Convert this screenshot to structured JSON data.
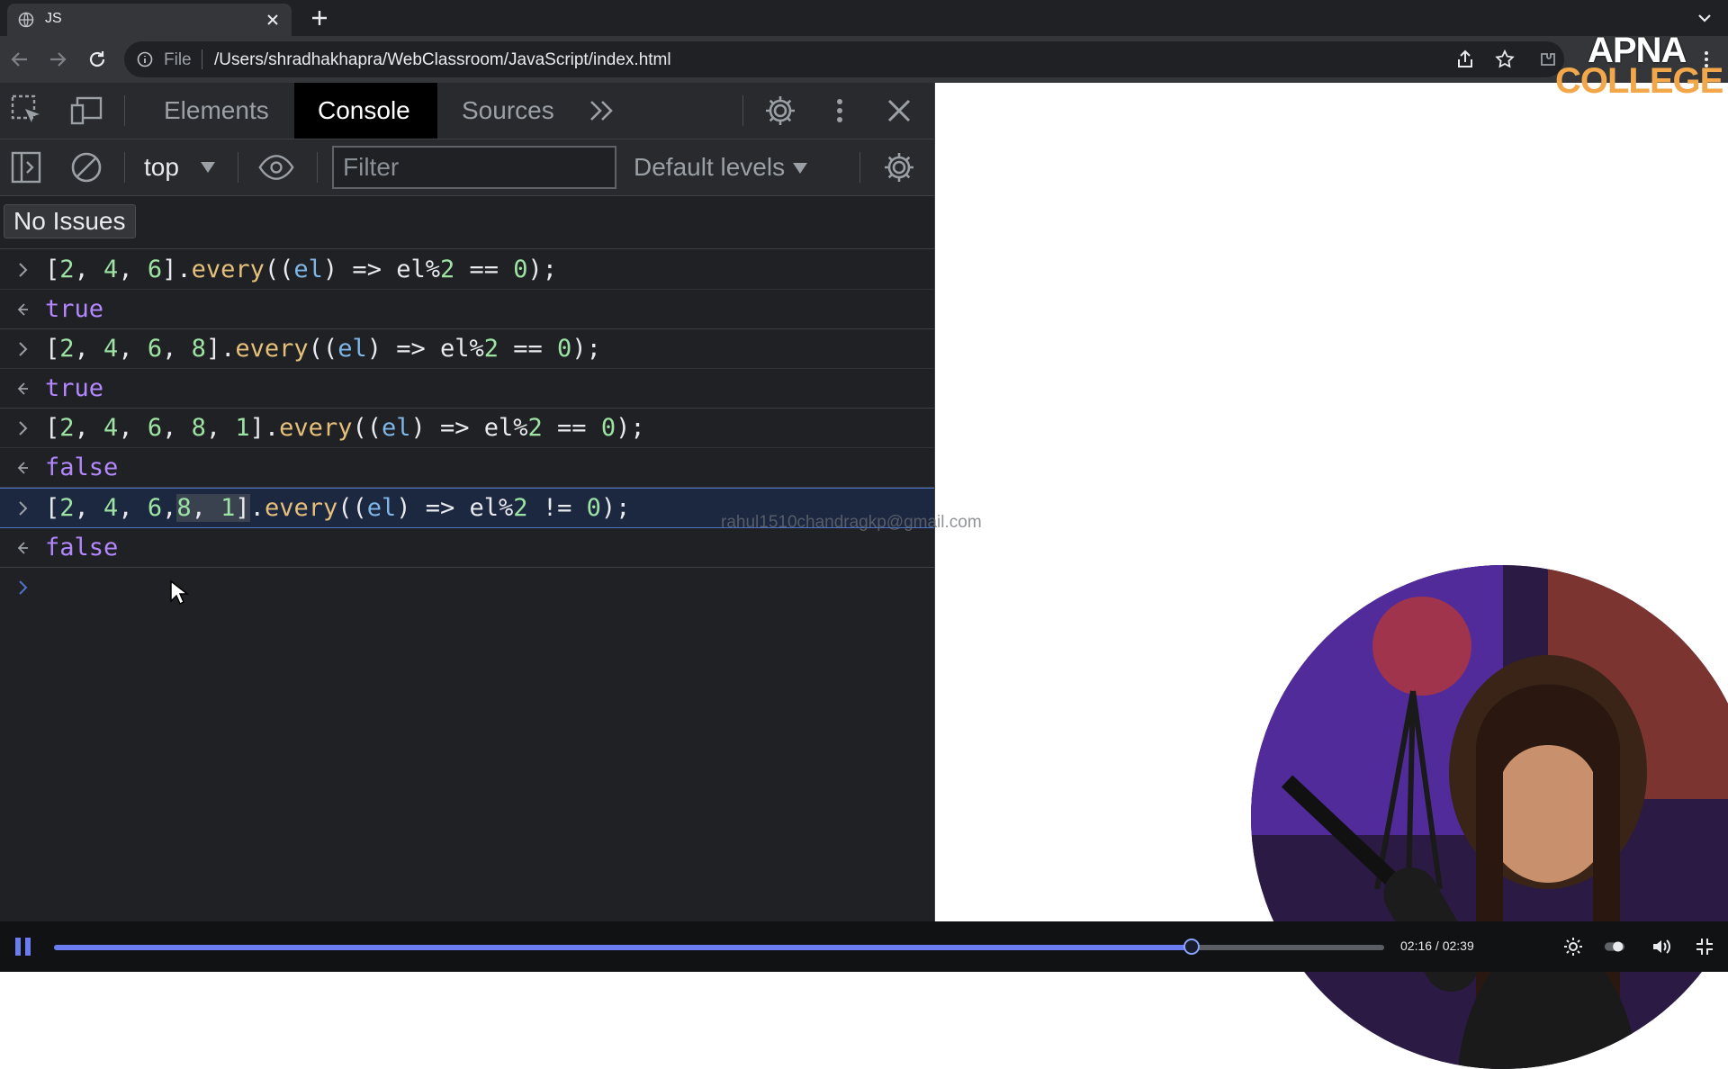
{
  "browser": {
    "tab": {
      "title": "JS",
      "favicon": "globe-icon"
    },
    "omnibox": {
      "scheme": "File",
      "url": "/Users/shradhakhapra/WebClassroom/JavaScript/index.html"
    }
  },
  "logo": {
    "line1": "APNA",
    "line2": "COLLEGE"
  },
  "devtools": {
    "tabs": [
      {
        "label": "Elements"
      },
      {
        "label": "Console",
        "active": true
      },
      {
        "label": "Sources"
      }
    ],
    "console_toolbar": {
      "context": "top",
      "filter_placeholder": "Filter",
      "levels": "Default levels"
    },
    "issues": "No Issues",
    "entries": [
      {
        "input": "[2, 4, 6].every((el) => el%2 == 0);",
        "output": "true"
      },
      {
        "input": "[2, 4, 6, 8].every((el) => el%2 == 0);",
        "output": "true"
      },
      {
        "input": "[2, 4, 6, 8, 1].every((el) => el%2 == 0);",
        "output": "false"
      },
      {
        "input": "[2, 4, 6, 8, 1].every((el) => el%2 != 0);",
        "output": "false",
        "selected": true
      }
    ],
    "watermark": "rahul1510chandragkp@gmail.com"
  },
  "player": {
    "time": "02:16 / 02:39",
    "progress_fraction": 0.855,
    "accent": "#6a7cf0"
  }
}
